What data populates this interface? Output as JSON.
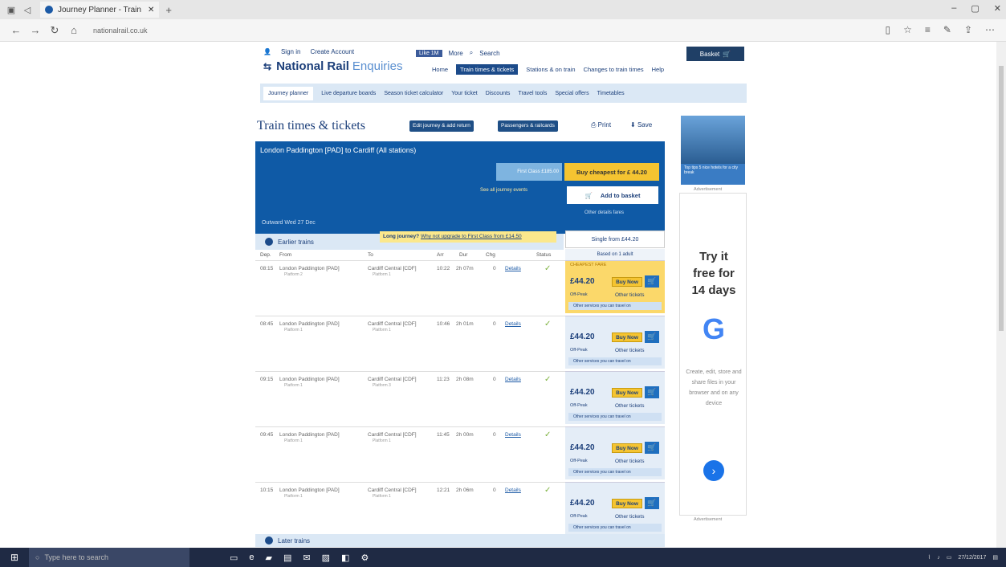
{
  "browser": {
    "tab_title": "Journey Planner - Train",
    "url_domain": "nationalrail.co.uk",
    "new_tab": "+",
    "back": "←",
    "forward": "→",
    "refresh": "↻",
    "home": "⌂",
    "minimize": "–",
    "maximize": "▢",
    "close": "✕",
    "tab_close": "✕"
  },
  "site": {
    "top_links": [
      "Sign in",
      "Create Account"
    ],
    "brand": "National Rail",
    "brand_suffix": "Enquiries",
    "social": [
      "Like 1M",
      "More",
      "Search"
    ],
    "basket": "Basket",
    "main_nav": [
      "Home",
      "Train times & tickets",
      "Stations & on train",
      "Changes to train times",
      "Help"
    ],
    "sub_nav": [
      "Journey planner",
      "Live departure boards",
      "Season ticket calculator",
      "Your ticket",
      "Discounts",
      "Travel tools",
      "Special offers",
      "Timetables"
    ],
    "page_title": "Train times & tickets",
    "btn_edit": "Edit journey & add return",
    "btn_passengers": "Passengers & railcards",
    "print": "Print",
    "save": "Save"
  },
  "journey": {
    "route": "London Paddington [PAD] to Cardiff (All stations)",
    "first_class": "First Class",
    "first_class_price": "£185.00",
    "buy_cheapest": "Buy cheapest for £ 44.20",
    "see_all": "See all journey events",
    "add_basket": "Add to basket",
    "other_details": "Other details fares",
    "outward": "Outward Wed 27 Dec"
  },
  "results": {
    "earlier": "Earlier trains",
    "promo_lead": "Long journey?",
    "promo_link": "Why not upgrade to First Class from £14.50",
    "single_from": "Single from £44.20",
    "based_on": "Based on 1 adult",
    "headers": [
      "Dep.",
      "From",
      "To",
      "Arr",
      "Dur",
      "Chg",
      "Status"
    ],
    "cheapest_tag": "CHEAPEST FARE",
    "buy_now": "Buy Now",
    "fare_type": "Off-Peak",
    "other_tickets": "Other tickets",
    "services_note": "Other services you can travel on",
    "details_label": "Details",
    "later": "Later trains",
    "rows": [
      {
        "dep": "08:15",
        "from": "London Paddington [PAD]",
        "from_pl": "Platform 2",
        "to": "Cardiff Central [CDF]",
        "to_pl": "Platform 1",
        "arr": "10:22",
        "dur": "2h 07m",
        "chg": "0",
        "price": "£44.20"
      },
      {
        "dep": "08:45",
        "from": "London Paddington [PAD]",
        "from_pl": "Platform 1",
        "to": "Cardiff Central [CDF]",
        "to_pl": "Platform 1",
        "arr": "10:46",
        "dur": "2h 01m",
        "chg": "0",
        "price": "£44.20"
      },
      {
        "dep": "09:15",
        "from": "London Paddington [PAD]",
        "from_pl": "Platform 1",
        "to": "Cardiff Central [CDF]",
        "to_pl": "Platform 3",
        "arr": "11:23",
        "dur": "2h 08m",
        "chg": "0",
        "price": "£44.20"
      },
      {
        "dep": "09:45",
        "from": "London Paddington [PAD]",
        "from_pl": "Platform 1",
        "to": "Cardiff Central [CDF]",
        "to_pl": "Platform 1",
        "arr": "11:45",
        "dur": "2h 00m",
        "chg": "0",
        "price": "£44.20"
      },
      {
        "dep": "10:15",
        "from": "London Paddington [PAD]",
        "from_pl": "Platform 1",
        "to": "Cardiff Central [CDF]",
        "to_pl": "Platform 1",
        "arr": "12:21",
        "dur": "2h 06m",
        "chg": "0",
        "price": "£44.20"
      }
    ]
  },
  "ads": {
    "ad1_caption": "Top tips 5 nice hotels for a city break",
    "advertisement": "Advertisement",
    "try_line1": "Try it",
    "try_line2": "free for",
    "try_line3": "14 days",
    "g_letter": "G",
    "desc": "Create, edit, store and share files in your browser and on any device",
    "arrow": "›"
  },
  "taskbar": {
    "search": "Type here to search",
    "date": "27/12/2017"
  }
}
